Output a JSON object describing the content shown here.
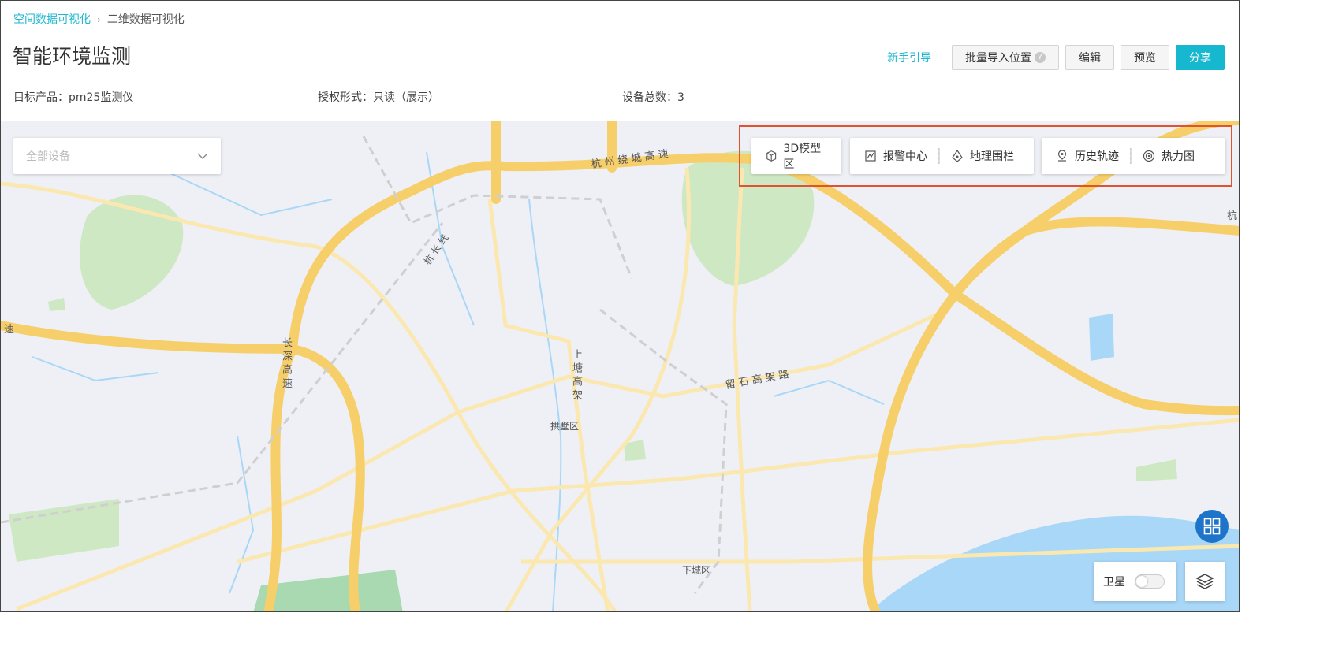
{
  "breadcrumb": {
    "parent": "空间数据可视化",
    "separator": "›",
    "current": "二维数据可视化"
  },
  "page": {
    "title": "智能环境监测"
  },
  "header_actions": {
    "guide": "新手引导",
    "batch_import": "批量导入位置",
    "help_glyph": "?",
    "edit": "编辑",
    "preview": "预览",
    "share": "分享"
  },
  "meta": {
    "product": "目标产品：pm25监测仪",
    "permission": "授权形式：只读（展示）",
    "device_count": "设备总数：3"
  },
  "map": {
    "device_select_placeholder": "全部设备",
    "toolbar": {
      "model_zone": "3D模型区",
      "alarm_center": "报警中心",
      "geo_fence": "地理围栏",
      "history_track": "历史轨迹",
      "heatmap": "热力图"
    },
    "satellite_label": "卫星",
    "labels": {
      "expressway_north": "杭 州 绕 城 高 速",
      "hangchang": "杭 长 线",
      "changshen": "长 深 高 速",
      "shangtang": "上 塘 高 架",
      "gongshu": "拱墅区",
      "liushi": "留 石 高 架 路",
      "xiacheng": "下城区",
      "east_road": "杭",
      "west_edge": "速"
    }
  },
  "colors": {
    "accent": "#15b8cf",
    "highlight_border": "#e0532f",
    "road_major": "#f7cf6a",
    "road_minor": "#fbe8b0",
    "water": "#a9d7f7",
    "green": "#cfe8c4",
    "map_bg": "#eef0f5",
    "fab": "#1e74c8"
  }
}
